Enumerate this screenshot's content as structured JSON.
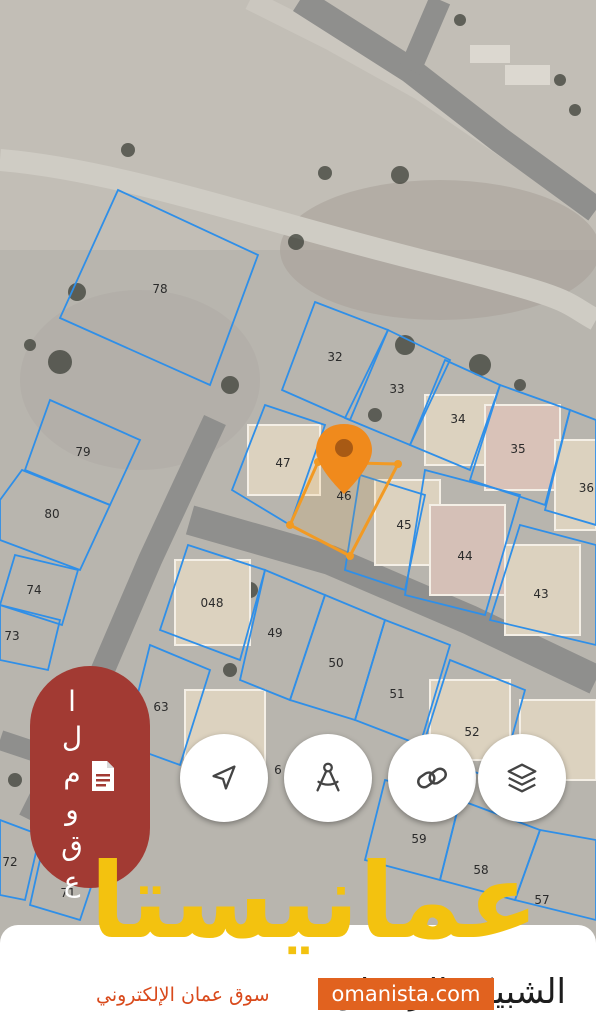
{
  "map": {
    "parcels": [
      {
        "id": "78",
        "label": "78"
      },
      {
        "id": "79",
        "label": "79"
      },
      {
        "id": "80",
        "label": "80"
      },
      {
        "id": "74",
        "label": "74"
      },
      {
        "id": "73",
        "label": "73"
      },
      {
        "id": "32",
        "label": "32"
      },
      {
        "id": "33",
        "label": "33"
      },
      {
        "id": "34",
        "label": "34"
      },
      {
        "id": "35",
        "label": "35"
      },
      {
        "id": "36",
        "label": "36"
      },
      {
        "id": "47",
        "label": "47"
      },
      {
        "id": "46",
        "label": "46"
      },
      {
        "id": "45",
        "label": "45"
      },
      {
        "id": "44",
        "label": "44"
      },
      {
        "id": "43",
        "label": "43"
      },
      {
        "id": "048",
        "label": "048"
      },
      {
        "id": "49",
        "label": "49"
      },
      {
        "id": "50",
        "label": "50"
      },
      {
        "id": "51",
        "label": "51"
      },
      {
        "id": "52",
        "label": "52"
      },
      {
        "id": "63",
        "label": "63"
      },
      {
        "id": "6",
        "label": "6"
      },
      {
        "id": "59",
        "label": "59"
      },
      {
        "id": "58",
        "label": "58"
      },
      {
        "id": "57",
        "label": "57"
      },
      {
        "id": "72",
        "label": "72"
      },
      {
        "id": "71",
        "label": "71"
      }
    ],
    "selected_parcel": "46",
    "colors": {
      "parcel_border": "#2f8fe8",
      "selection": "#f29a23",
      "marker": "#f08a1c",
      "ground": "#b7b4ad",
      "road": "#8f8f8d"
    }
  },
  "controls": [
    {
      "name": "locate",
      "icon": "navigation-arrow-icon"
    },
    {
      "name": "measure",
      "icon": "compass-drafting-icon"
    },
    {
      "name": "link",
      "icon": "link-icon"
    },
    {
      "name": "layers",
      "icon": "layers-icon"
    }
  ],
  "side_panel": {
    "letters": [
      "ا",
      "ل",
      "م",
      "و",
      "ق",
      "ع"
    ],
    "icon": "document-icon",
    "color": "#a23a33"
  },
  "bottom_sheet": {
    "title": "الشبيكة الرستاق"
  },
  "watermark": {
    "brand": "عمانيستا",
    "tagline": "سوق عمان الإلكتروني",
    "site": "omanista.com",
    "brand_color": "#f3c20f",
    "badge_color": "#e1621f"
  }
}
